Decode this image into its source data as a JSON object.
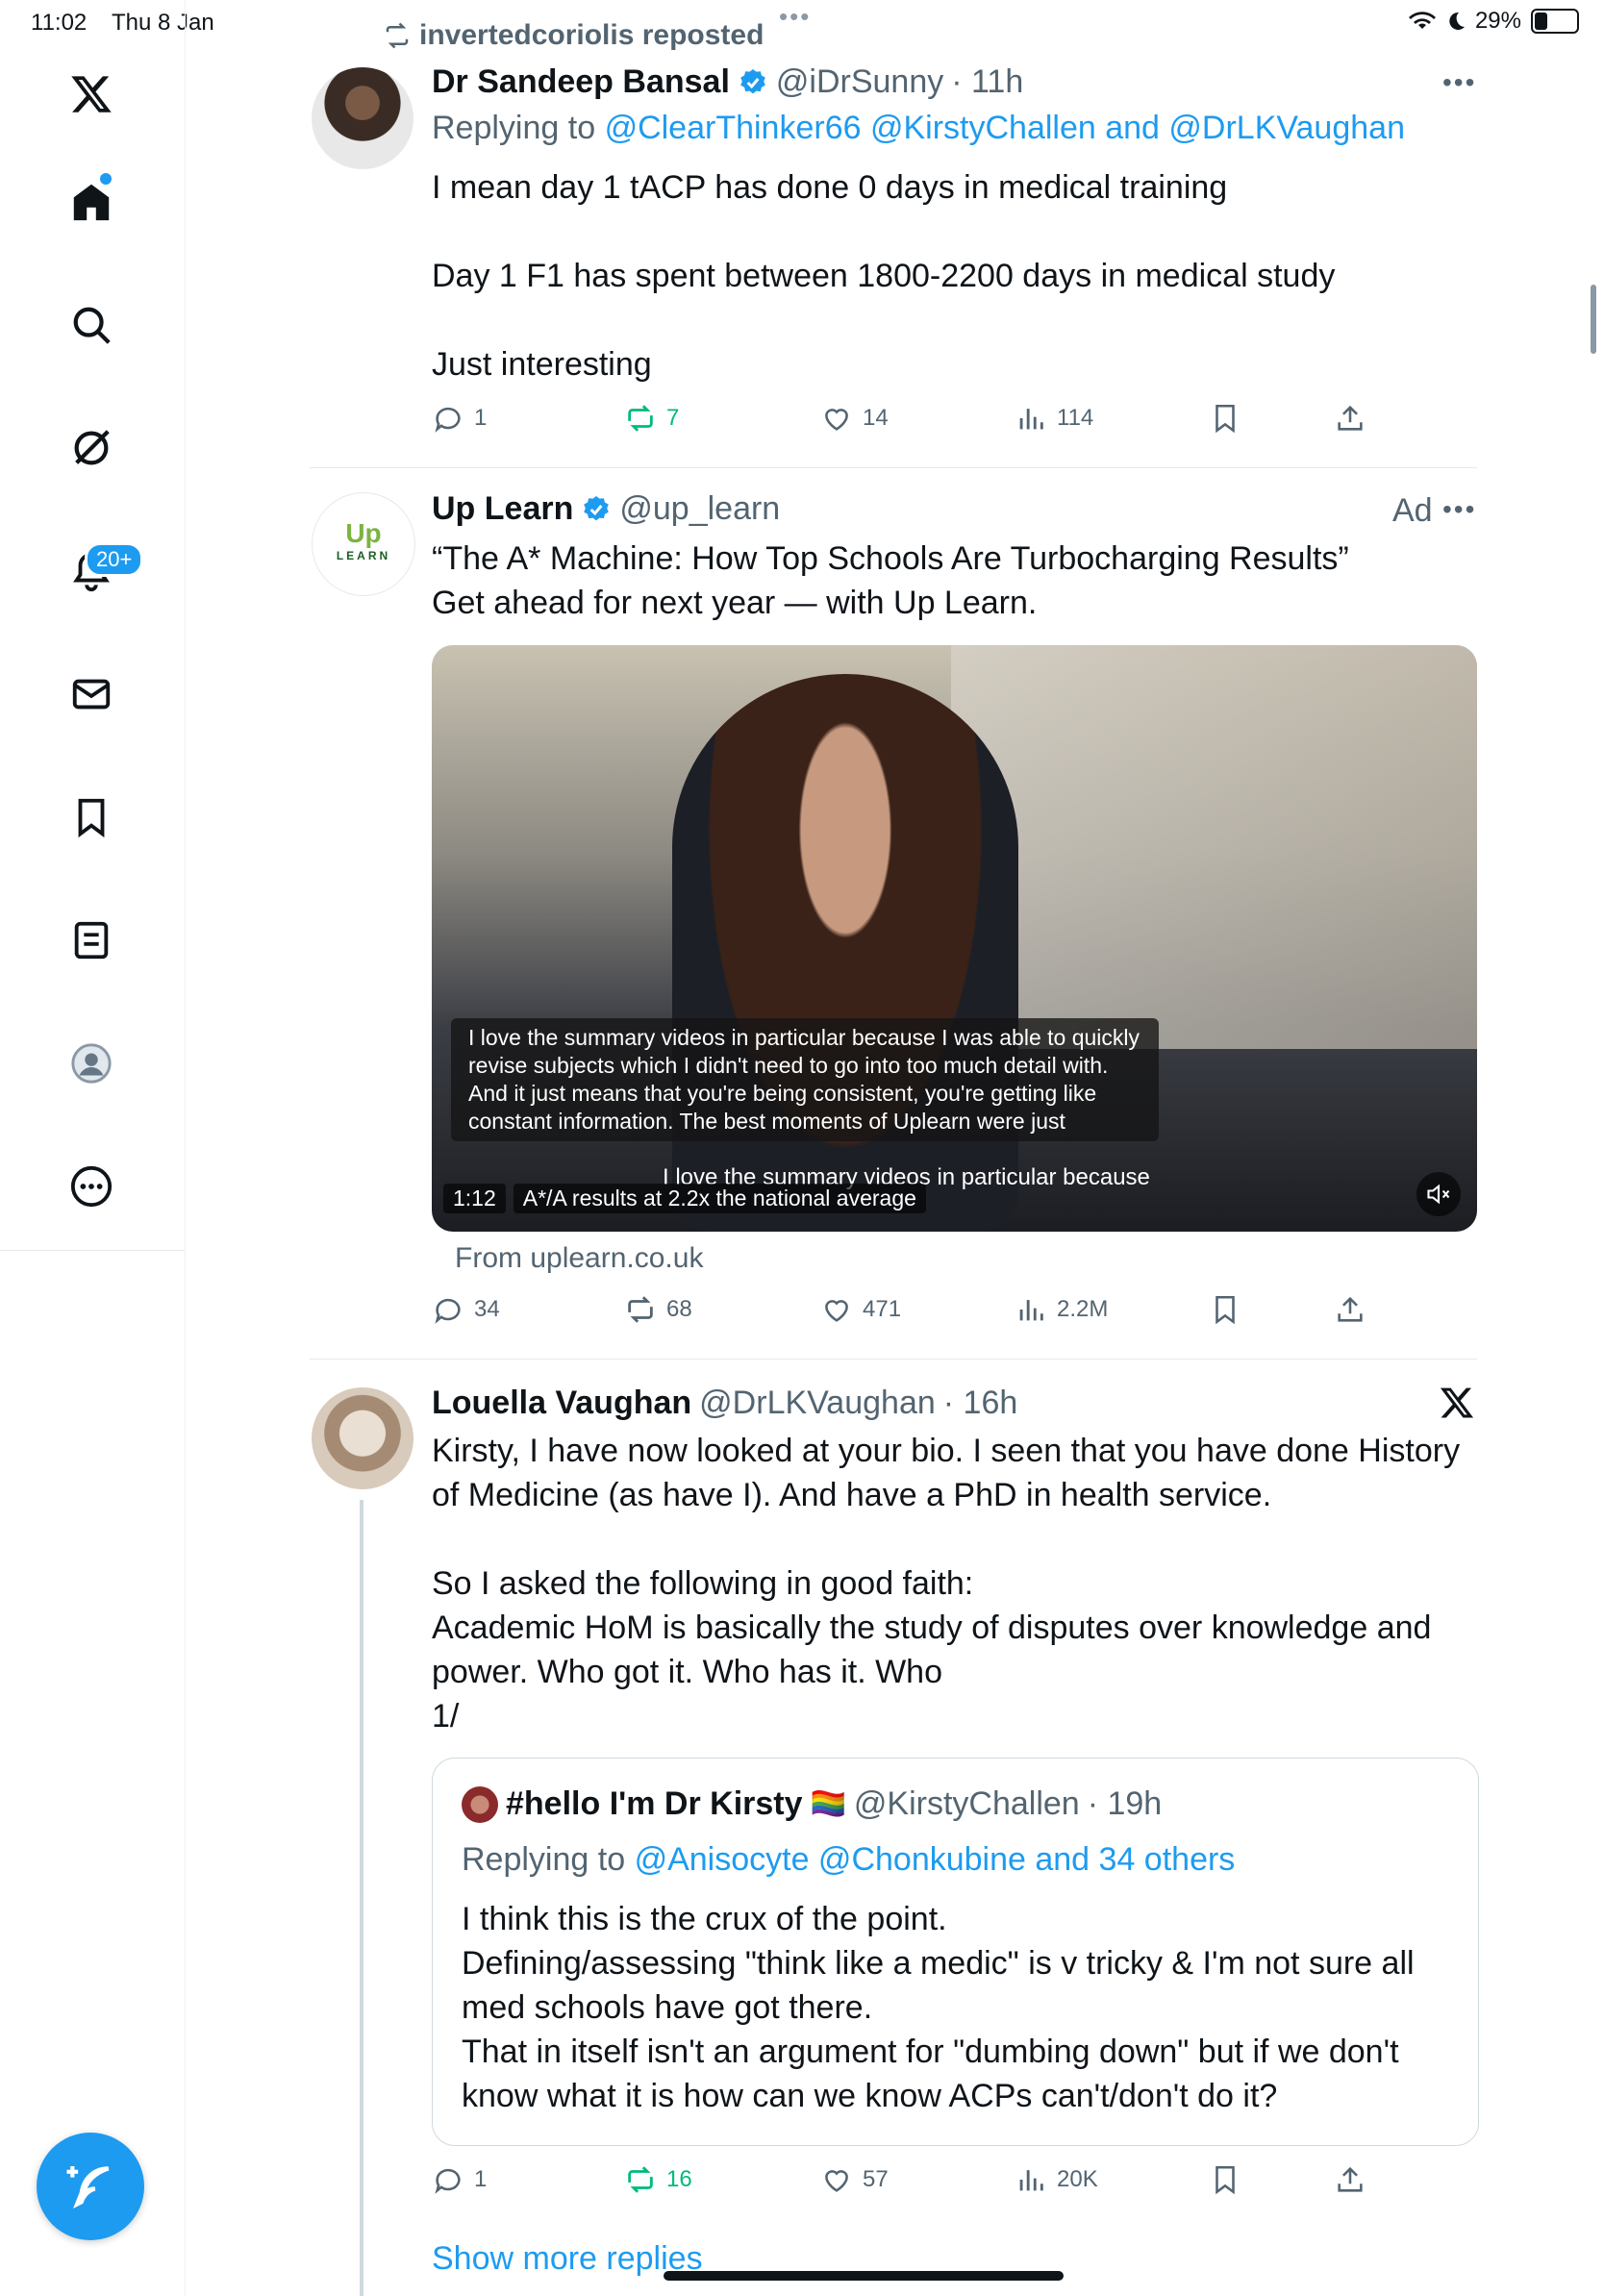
{
  "status": {
    "time": "11:02",
    "date": "Thu 8 Jan",
    "battery": "29%",
    "battery_level": 0.29
  },
  "sidebar": {
    "notifications_badge": "20+",
    "items": [
      {
        "name": "x-logo"
      },
      {
        "name": "home"
      },
      {
        "name": "search"
      },
      {
        "name": "grok"
      },
      {
        "name": "notifications"
      },
      {
        "name": "messages"
      },
      {
        "name": "bookmarks"
      },
      {
        "name": "lists"
      },
      {
        "name": "profile"
      },
      {
        "name": "more"
      }
    ]
  },
  "post1": {
    "repost_label": "invertedcoriolis reposted",
    "author": "Dr Sandeep Bansal",
    "handle": "@iDrSunny",
    "time": "· 11h",
    "replying_prefix": "Replying to",
    "replying_to": "@ClearThinker66 @KirstyChallen and @DrLKVaughan",
    "text": "I mean day 1 tACP has done 0 days in medical training\n\nDay 1 F1 has spent between 1800-2200 days in medical study\n\nJust interesting",
    "replies": "1",
    "reposts": "7",
    "likes": "14",
    "views": "114"
  },
  "ad": {
    "author": "Up Learn",
    "handle": "@up_learn",
    "ad_label": "Ad",
    "logo_top": "Up",
    "logo_bottom": "LEARN",
    "text": "“The A* Machine: How Top Schools Are Turbocharging Results”\nGet ahead for next year — with Up Learn.",
    "caption": "I love the summary videos in particular because I was able to quickly revise subjects which I didn't need to go into too much detail with. And it just means that you're being consistent, you're getting like constant information. The best moments of Uplearn were just",
    "subtitle": "I love the summary videos in particular because",
    "duration": "1:12",
    "video_title": "A*/A results at 2.2x the national average",
    "source": "From uplearn.co.uk",
    "replies": "34",
    "reposts": "68",
    "likes": "471",
    "views": "2.2M"
  },
  "post3": {
    "author": "Louella Vaughan",
    "handle": "@DrLKVaughan",
    "time": "· 16h",
    "text": "Kirsty, I have now looked at your bio. I seen that you have done History of Medicine (as have I). And have a PhD in health service.\n\nSo I asked the following in good faith:\nAcademic HoM is basically the study of disputes over knowledge and power. Who got it. Who has it. Who\n1/",
    "quote": {
      "author": "#hello I'm Dr Kirsty",
      "flag": "🏳️‍🌈",
      "handle": "@KirstyChallen",
      "time": "· 19h",
      "replying_prefix": "Replying to",
      "replying_to": "@Anisocyte @Chonkubine and 34 others",
      "text": "I think this is the crux of the point.\nDefining/assessing \"think like a medic\" is v tricky & I'm not sure all med schools have got there.\nThat in itself isn't an argument for \"dumbing down\" but if we don't know what it is how can we know ACPs can't/don't do it?"
    },
    "replies": "1",
    "reposts": "16",
    "likes": "57",
    "views": "20K",
    "show_more": "Show more replies"
  },
  "colors": {
    "accent": "#1d9bf0",
    "repost": "#00ba7c",
    "muted": "#536471",
    "text": "#0f1419"
  }
}
